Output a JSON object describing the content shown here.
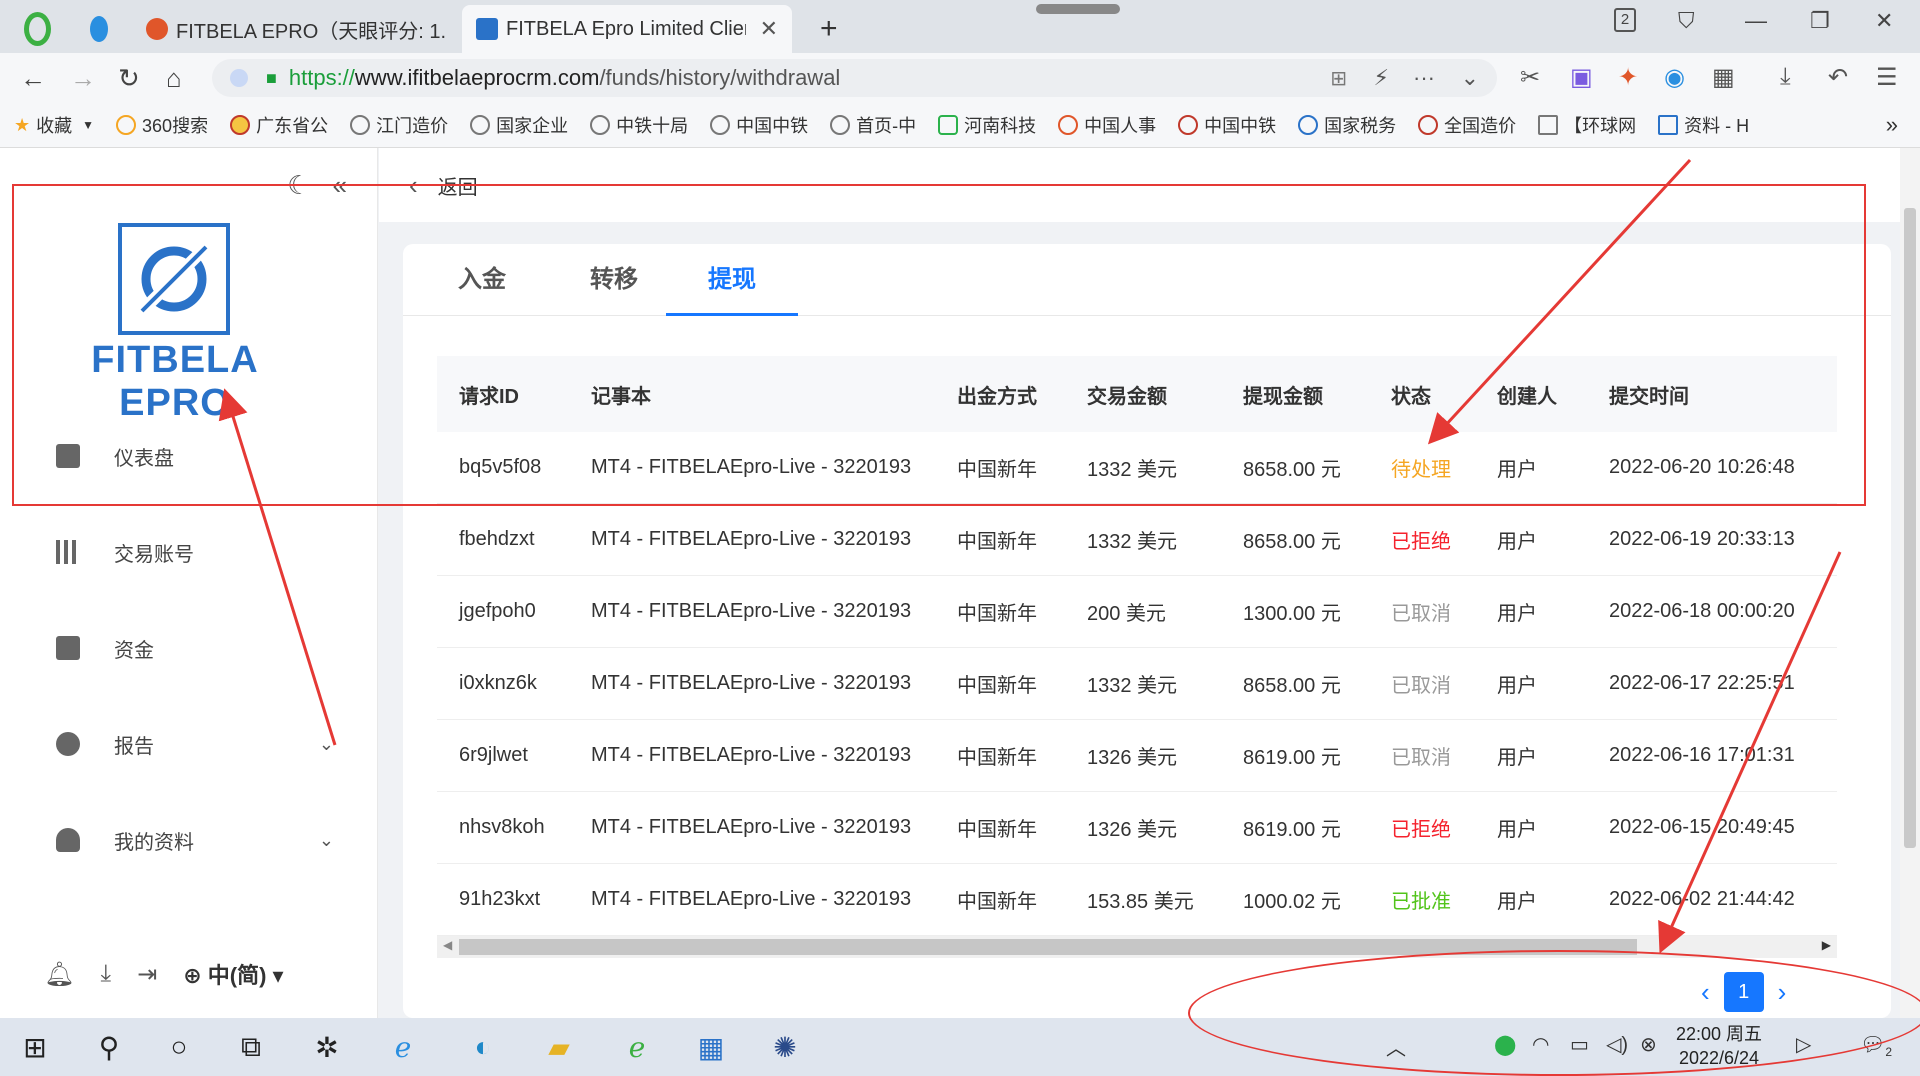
{
  "browser": {
    "tabs": [
      {
        "title": "FITBELA EPRO（天眼评分: 1.",
        "active": false,
        "favicon_color": "#e0562a"
      },
      {
        "title": "FITBELA Epro Limited Client",
        "active": true,
        "favicon_color": "#2a72c8"
      }
    ],
    "tab_count_badge": "2",
    "url": {
      "scheme": "https://",
      "host": "www.ifitbelaeprocrm.com",
      "path": "/funds/history/withdrawal"
    },
    "bookmarks": [
      {
        "label": "收藏",
        "icon": "star-icon"
      },
      {
        "label": "360搜索",
        "icon": "360-icon"
      },
      {
        "label": "广东省公",
        "icon": "emblem-icon"
      },
      {
        "label": "江门造价",
        "icon": "globe-icon"
      },
      {
        "label": "国家企业",
        "icon": "globe-icon"
      },
      {
        "label": "中铁十局",
        "icon": "globe-icon"
      },
      {
        "label": "中国中铁",
        "icon": "globe-icon"
      },
      {
        "label": "首页-中",
        "icon": "globe-icon"
      },
      {
        "label": "河南科技",
        "icon": "globe-icon"
      },
      {
        "label": "中国人事",
        "icon": "globe-icon"
      },
      {
        "label": "中国中铁",
        "icon": "globe-icon"
      },
      {
        "label": "国家税务",
        "icon": "globe-icon"
      },
      {
        "label": "全国造价",
        "icon": "globe-icon"
      },
      {
        "label": "【环球网",
        "icon": "globe-icon"
      },
      {
        "label": "资料 - H",
        "icon": "globe-icon"
      }
    ]
  },
  "sidebar": {
    "logo_text": "FITBELA EPRO",
    "menu": [
      {
        "label": "仪表盘",
        "icon": "dashboard-icon",
        "has_children": false
      },
      {
        "label": "交易账号",
        "icon": "chart-candles-icon",
        "has_children": false
      },
      {
        "label": "资金",
        "icon": "wallet-icon",
        "has_children": false
      },
      {
        "label": "报告",
        "icon": "pie-chart-icon",
        "has_children": true
      },
      {
        "label": "我的资料",
        "icon": "user-icon",
        "has_children": true
      }
    ],
    "language": "中(简)"
  },
  "content": {
    "back_label": "返回",
    "tabs": [
      {
        "label": "入金",
        "active": false
      },
      {
        "label": "转移",
        "active": false
      },
      {
        "label": "提现",
        "active": true
      }
    ],
    "table": {
      "headers": [
        "请求ID",
        "记事本",
        "出金方式",
        "交易金额",
        "提现金额",
        "状态",
        "创建人",
        "提交时间"
      ],
      "rows": [
        {
          "id": "bq5v5f08",
          "note": "MT4 - FITBELAEpro-Live - 3220193",
          "method": "中国新年",
          "trade_amount": "1332 美元",
          "withdraw_amount": "8658.00 元",
          "status": "待处理",
          "status_type": "pending",
          "creator": "用户",
          "time": "2022-06-20 10:26:48"
        },
        {
          "id": "fbehdzxt",
          "note": "MT4 - FITBELAEpro-Live - 3220193",
          "method": "中国新年",
          "trade_amount": "1332 美元",
          "withdraw_amount": "8658.00 元",
          "status": "已拒绝",
          "status_type": "rejected",
          "creator": "用户",
          "time": "2022-06-19 20:33:13"
        },
        {
          "id": "jgefpoh0",
          "note": "MT4 - FITBELAEpro-Live - 3220193",
          "method": "中国新年",
          "trade_amount": "200 美元",
          "withdraw_amount": "1300.00 元",
          "status": "已取消",
          "status_type": "cancelled",
          "creator": "用户",
          "time": "2022-06-18 00:00:20"
        },
        {
          "id": "i0xknz6k",
          "note": "MT4 - FITBELAEpro-Live - 3220193",
          "method": "中国新年",
          "trade_amount": "1332 美元",
          "withdraw_amount": "8658.00 元",
          "status": "已取消",
          "status_type": "cancelled",
          "creator": "用户",
          "time": "2022-06-17 22:25:51"
        },
        {
          "id": "6r9jlwet",
          "note": "MT4 - FITBELAEpro-Live - 3220193",
          "method": "中国新年",
          "trade_amount": "1326 美元",
          "withdraw_amount": "8619.00 元",
          "status": "已取消",
          "status_type": "cancelled",
          "creator": "用户",
          "time": "2022-06-16 17:01:31"
        },
        {
          "id": "nhsv8koh",
          "note": "MT4 - FITBELAEpro-Live - 3220193",
          "method": "中国新年",
          "trade_amount": "1326 美元",
          "withdraw_amount": "8619.00 元",
          "status": "已拒绝",
          "status_type": "rejected",
          "creator": "用户",
          "time": "2022-06-15 20:49:45"
        },
        {
          "id": "91h23kxt",
          "note": "MT4 - FITBELAEpro-Live - 3220193",
          "method": "中国新年",
          "trade_amount": "153.85 美元",
          "withdraw_amount": "1000.02 元",
          "status": "已批准",
          "status_type": "approved",
          "creator": "用户",
          "time": "2022-06-02 21:44:42"
        }
      ]
    },
    "pagination": {
      "current_page": "1"
    }
  },
  "taskbar": {
    "time": "22:00 周五",
    "date": "2022/6/24",
    "notification_count": "2"
  },
  "colors": {
    "brand_blue": "#2a72c8",
    "accent": "#1677ff",
    "pending": "#f5a623",
    "rejected": "#f5222d",
    "cancelled": "#999999",
    "approved": "#52c41a",
    "annotation_red": "#e53935"
  }
}
